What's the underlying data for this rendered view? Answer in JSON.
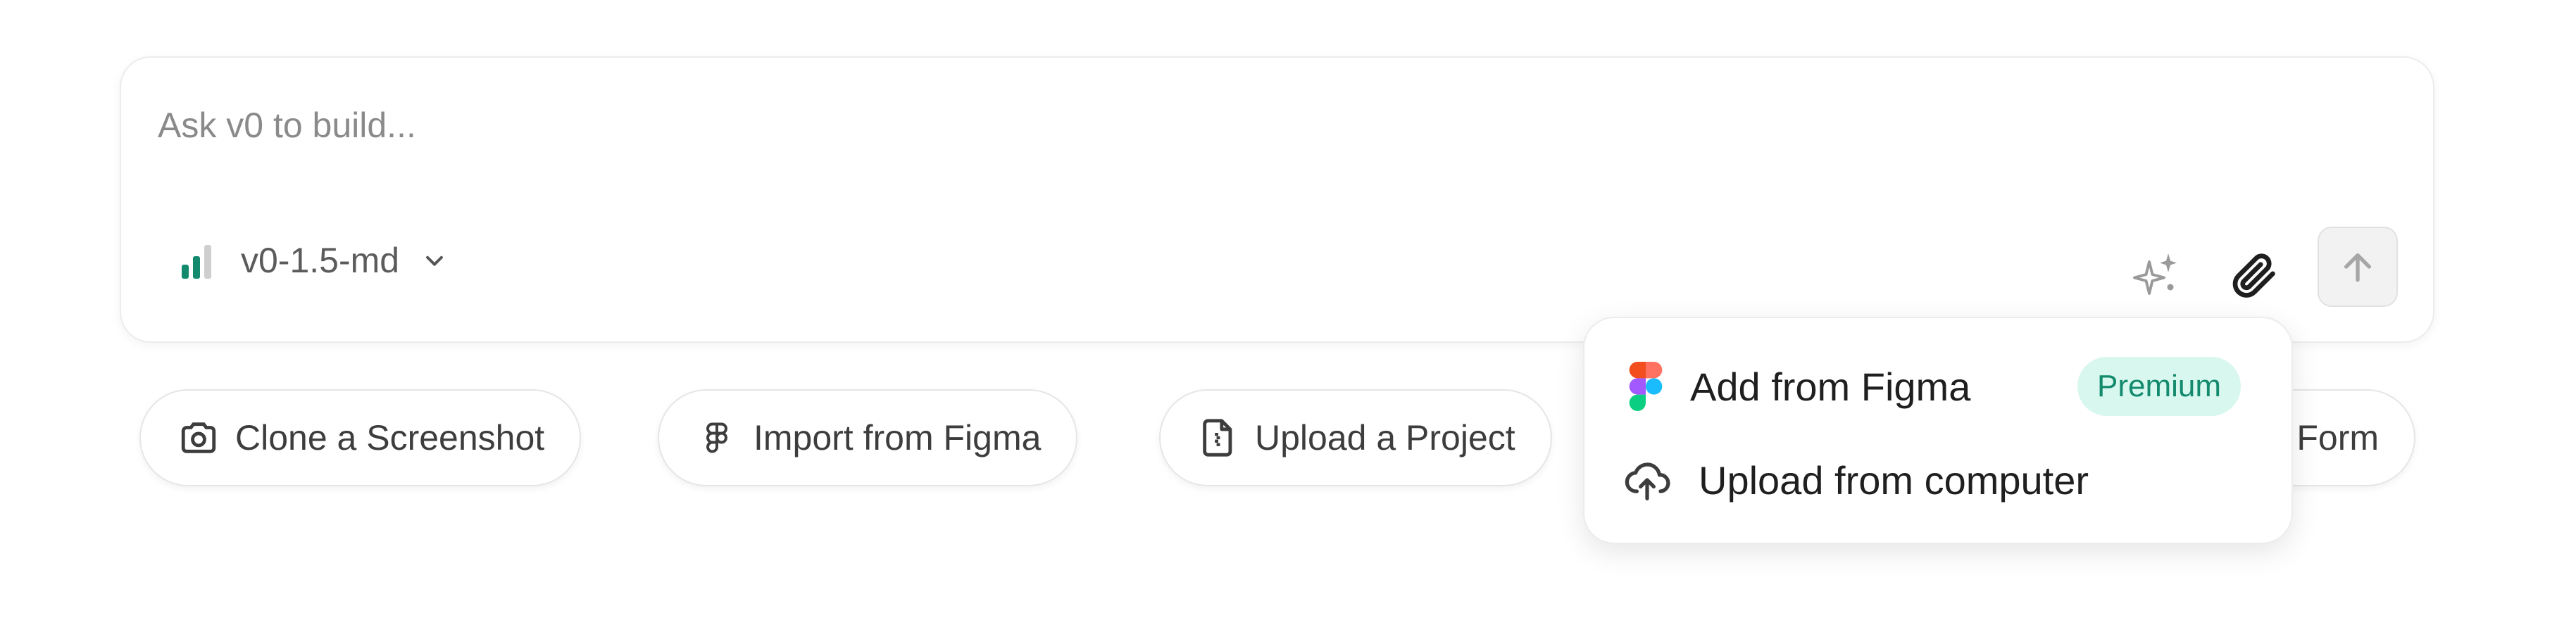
{
  "prompt": {
    "placeholder": "Ask v0 to build..."
  },
  "model": {
    "label": "v0-1.5-md",
    "icon": "signal-bars-icon",
    "accent": "#138a6d"
  },
  "tools": {
    "enhance_icon": "sparkles-icon",
    "attach_icon": "paperclip-icon",
    "send_icon": "arrow-up-icon"
  },
  "chips": [
    {
      "label": "Clone a Screenshot",
      "icon": "camera-icon"
    },
    {
      "label": "Import from Figma",
      "icon": "figma-icon"
    },
    {
      "label": "Upload a Project",
      "icon": "file-zip-icon"
    },
    {
      "label": "Form",
      "icon": ""
    }
  ],
  "attach_menu": {
    "items": [
      {
        "label": "Add from Figma",
        "icon": "figma-color-icon",
        "badge": "Premium"
      },
      {
        "label": "Upload from computer",
        "icon": "cloud-upload-icon"
      }
    ],
    "badge_bg": "#d8f7ee",
    "badge_color": "#138a6d"
  }
}
